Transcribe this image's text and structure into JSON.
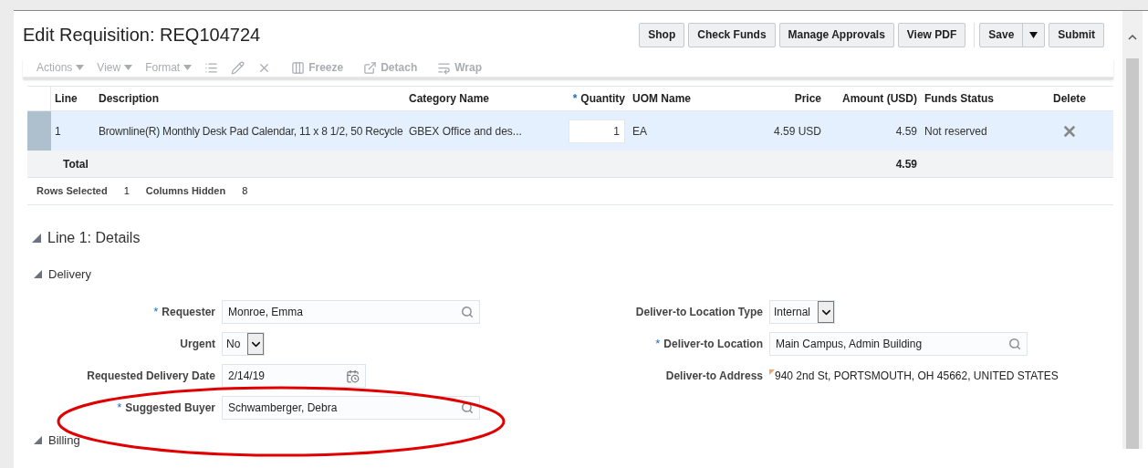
{
  "page": {
    "title": "Edit Requisition: REQ104724"
  },
  "actions": [
    {
      "label": "Shop",
      "kind": "button"
    },
    {
      "label": "Check Funds",
      "kind": "button"
    },
    {
      "label": "Manage Approvals",
      "kind": "button"
    },
    {
      "label": "View PDF",
      "kind": "button"
    },
    {
      "label": "Save",
      "kind": "split"
    },
    {
      "label": "Submit",
      "kind": "button"
    }
  ],
  "toolbar": [
    {
      "label": "Actions",
      "kind": "menu",
      "disabled": true
    },
    {
      "label": "View",
      "kind": "menu",
      "disabled": true
    },
    {
      "label": "Format",
      "kind": "menu",
      "disabled": true
    },
    {
      "kind": "icon",
      "disabled": true
    },
    {
      "kind": "icon",
      "disabled": true
    },
    {
      "kind": "icon",
      "disabled": true
    },
    {
      "label": "Freeze",
      "kind": "icon-text",
      "disabled": true
    },
    {
      "label": "Detach",
      "kind": "icon-text",
      "disabled": true
    },
    {
      "label": "Wrap",
      "kind": "icon-text",
      "disabled": true
    }
  ],
  "table": {
    "columns": [
      {
        "label": "Line"
      },
      {
        "label": "Description"
      },
      {
        "label": "Category Name"
      },
      {
        "label": "Quantity",
        "required_mark": "*"
      },
      {
        "label": "UOM Name"
      },
      {
        "label": "Price"
      },
      {
        "label": "Amount (USD)"
      },
      {
        "label": "Funds Status"
      },
      {
        "label": "Delete"
      }
    ],
    "rows": [
      {
        "selected": true,
        "line": "1",
        "description": "Brownline(R) Monthly Desk Pad Calendar, 11 x 8 1/2, 50 Recycle",
        "category": "GBEX Office and des...",
        "quantity": "1",
        "uom": "EA",
        "price": "4.59 USD",
        "amount": "4.59",
        "funds_status": "Not reserved"
      }
    ],
    "total": {
      "label": "Total",
      "amount": "4.59"
    },
    "status": [
      {
        "label": "Rows Selected",
        "value": "1"
      },
      {
        "label": "Columns Hidden",
        "value": "8"
      }
    ]
  },
  "details": {
    "title": "Line 1: Details",
    "expanded": true,
    "sections": [
      {
        "title": "Delivery",
        "expanded": true,
        "left": [
          {
            "label": "Requester",
            "required_mark": "*",
            "kind": "lookup",
            "value": "Monroe, Emma"
          },
          {
            "label": "Urgent",
            "kind": "select",
            "value": "No"
          },
          {
            "label": "Requested Delivery Date",
            "kind": "date",
            "value": "2/14/19"
          },
          {
            "label": "Suggested Buyer",
            "required_mark": "*",
            "kind": "lookup",
            "value": "Schwamberger, Debra"
          }
        ],
        "right": [
          {
            "label": "Deliver-to Location Type",
            "kind": "select",
            "value": "Internal"
          },
          {
            "label": "Deliver-to Location",
            "required_mark": "*",
            "kind": "lookup",
            "value": "Main Campus, Admin Building"
          },
          {
            "label": "Deliver-to Address",
            "kind": "readonly",
            "value": "940 2nd St, PORTSMOUTH, OH 45662, UNITED STATES"
          }
        ]
      },
      {
        "title": "Billing",
        "expanded": true
      }
    ]
  }
}
